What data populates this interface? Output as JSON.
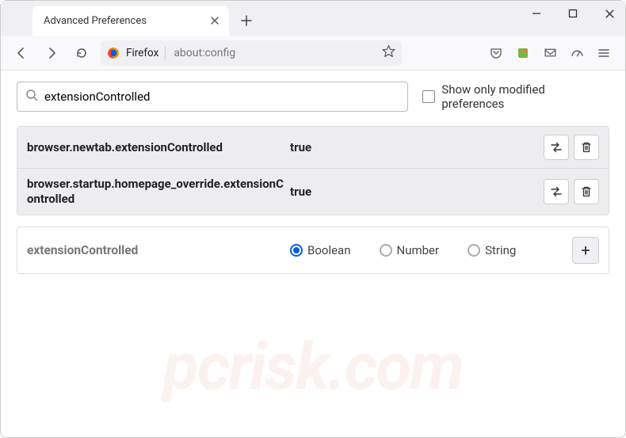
{
  "window": {
    "tab_title": "Advanced Preferences",
    "url_identity": "Firefox",
    "url_text": "about:config"
  },
  "search": {
    "value": "extensionControlled",
    "show_modified_label": "Show only modified preferences"
  },
  "prefs": [
    {
      "name": "browser.newtab.extensionControlled",
      "value": "true"
    },
    {
      "name": "browser.startup.homepage_override.extensionControlled",
      "value": "true"
    }
  ],
  "new_pref": {
    "name": "extensionControlled",
    "types": {
      "boolean": "Boolean",
      "number": "Number",
      "string": "String"
    },
    "selected": "boolean"
  },
  "watermark": "pcrisk.com"
}
